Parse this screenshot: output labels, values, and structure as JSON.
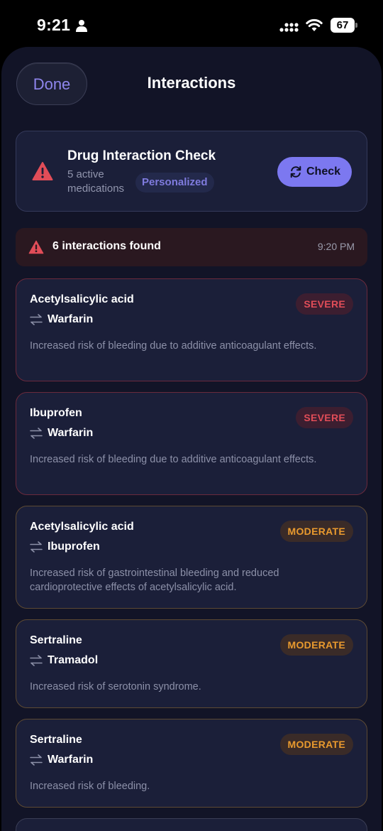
{
  "status_bar": {
    "time": "9:21",
    "battery": "67"
  },
  "nav": {
    "done_label": "Done",
    "title": "Interactions"
  },
  "check_card": {
    "title": "Drug Interaction Check",
    "subtitle": "5 active medications",
    "badge": "Personalized",
    "button_label": "Check"
  },
  "banner": {
    "text": "6 interactions found",
    "time": "9:20 PM"
  },
  "interactions": [
    {
      "drug_a": "Acetylsalicylic acid",
      "drug_b": "Warfarin",
      "severity": "SEVERE",
      "description": "Increased risk of bleeding due to additive anticoagulant effects."
    },
    {
      "drug_a": "Ibuprofen",
      "drug_b": "Warfarin",
      "severity": "SEVERE",
      "description": "Increased risk of bleeding due to additive anticoagulant effects."
    },
    {
      "drug_a": "Acetylsalicylic acid",
      "drug_b": "Ibuprofen",
      "severity": "MODERATE",
      "description": "Increased risk of gastrointestinal bleeding and reduced cardioprotective effects of acetylsalicylic acid."
    },
    {
      "drug_a": "Sertraline",
      "drug_b": "Tramadol",
      "severity": "MODERATE",
      "description": "Increased risk of serotonin syndrome."
    },
    {
      "drug_a": "Sertraline",
      "drug_b": "Warfarin",
      "severity": "MODERATE",
      "description": "Increased risk of bleeding."
    }
  ],
  "colors": {
    "accent": "#7c78f0",
    "severe": "#e14d58",
    "moderate": "#e99a2e",
    "card_background": "#1b1f39"
  },
  "icons": {
    "status_user": "person-icon",
    "signal": "cellular-signal-icon",
    "wifi": "wifi-icon",
    "warning": "warning-triangle-icon",
    "check": "refresh-icon",
    "pair": "swap-arrows-icon"
  }
}
